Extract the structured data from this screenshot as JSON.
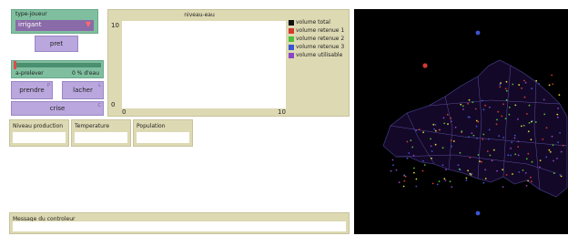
{
  "chooser": {
    "label": "type-joueur",
    "value": "irrigant"
  },
  "buttons": {
    "pret": "pret",
    "prendre": "prendre",
    "lacher": "lacher",
    "crise": "crise"
  },
  "slider": {
    "name": "a-prelever",
    "value_text": "0 % d'eau",
    "value_fraction": 0.0
  },
  "plot": {
    "title": "niveau-eau",
    "y_max": "10",
    "y_min": "0",
    "x_min": "0",
    "x_max": "10",
    "legend": [
      {
        "label": "volume total",
        "color": "#111111"
      },
      {
        "label": "volume retenue 1",
        "color": "#d33b2f"
      },
      {
        "label": "volume retenue 2",
        "color": "#4fbf3a"
      },
      {
        "label": "volume retenue 3",
        "color": "#3a55d3"
      },
      {
        "label": "volume utilisable",
        "color": "#8a45c8"
      }
    ]
  },
  "monitors": {
    "niveau": "Niveau production",
    "temperature": "Temperature",
    "population": "Population"
  },
  "message": {
    "label": "Message du controleur"
  },
  "view": {
    "background": "#000000",
    "accent_colors": [
      "#3a55d3",
      "#d33b2f",
      "#e0d63a",
      "#4fbf3a",
      "#8a45c8"
    ]
  }
}
